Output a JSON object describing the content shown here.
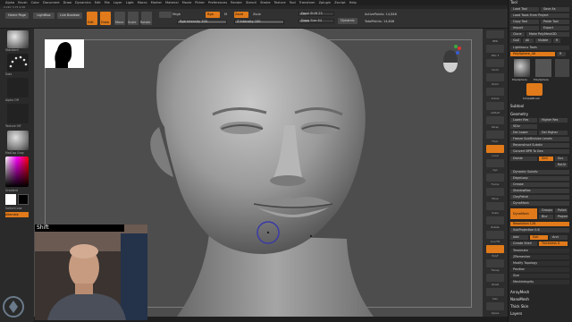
{
  "menu": [
    "Alpha",
    "Brush",
    "Color",
    "Document",
    "Draw",
    "Dynamics",
    "Edit",
    "File",
    "Layer",
    "Light",
    "Macro",
    "Marker",
    "Material",
    "Movie",
    "Picker",
    "Preferences",
    "Render",
    "Stencil",
    "Stroke",
    "Texture",
    "Tool",
    "Transform",
    "Zplugin",
    "Zscript",
    "Help"
  ],
  "version": "4.2R7 3.75 4:28",
  "toolbar": {
    "home_page": "Home Page",
    "lightbox": "LightBox",
    "live_boolean": "Live Boolean",
    "edit": "Edit",
    "draw": "Draw",
    "move": "Move",
    "scale": "Scale",
    "rotate": "Rotate",
    "mrgb": "Mrgb",
    "rgb": "Rgb",
    "m": "M",
    "zadd": "Zadd",
    "zsub": "Zsub",
    "rgb_intensity": "Rgb Intensity 100",
    "z_intensity": "Z Intensity 100",
    "focal_shift": "Focal Shift 25",
    "draw_size": "Draw Size 64",
    "dynamic": "Dynamic",
    "active_points": "ActivePoints: 14,846",
    "total_points": "TotalPoints: 14,846"
  },
  "left_shelf": {
    "brush": "Standard",
    "stroke": "Dots",
    "alpha": "Alpha Off",
    "texture": "Texture Off",
    "material": "MatCap Gray",
    "gradient": "Gradient",
    "switch_color": "SwitchColor",
    "alternate": "Alternate"
  },
  "right_shelf": [
    "BPR",
    "SPix 3",
    "Scroll",
    "Zoom",
    "Actual",
    "AAHalf",
    "Persp",
    "Floor",
    "Local",
    "Gyz",
    "Frame",
    "Move",
    "Scale",
    "Rotate",
    "Line Fill",
    "PolyF",
    "Transp",
    "Ghost",
    "Solo",
    "Xpose"
  ],
  "tray": {
    "title": "Tool",
    "load_tool": "Load Tool",
    "save_as": "Save As",
    "load_tools_from_project": "Load Tools From Project",
    "copy_tool": "Copy Tool",
    "paste_tool": "Paste Tool",
    "import": "Import",
    "export": "Export",
    "clone": "Clone",
    "make_polymesh": "Make PolyMesh3D",
    "goz": "GoZ",
    "all": "All",
    "visible": "Visible",
    "r": "R",
    "lightbox_tools": "Lightbox ▸ Tools",
    "current_tool": "PolySphere_48",
    "r_label": "R",
    "thumb_a": "PolySphere",
    "thumb_b": "PolySphere",
    "thumb_c": "SimpleBrush",
    "subtool": "Subtool",
    "geometry": "Geometry",
    "lower_res": "Lower Res",
    "higher_res": "Higher Res",
    "sdiv": "SDiv",
    "del_lower": "Del Lower",
    "del_higher": "Del Higher",
    "freeze": "Freeze SubDivision Levels",
    "reconstruct": "Reconstruct Subdiv",
    "convert_bpr": "Convert BPR To Geo",
    "divide": "Divide",
    "smt": "Smt",
    "suv": "Suv",
    "reuv": "ReUV",
    "dynamic_subdiv": "Dynamic Subdiv",
    "edgeloop": "EdgeLoop",
    "crease": "Crease",
    "shadowbox": "ShadowBox",
    "claypolish": "ClayPolish",
    "dynamesh": "DynaMesh",
    "dynamesh_btn": "DynaMesh",
    "groups": "Groups",
    "polish": "Polish",
    "blur": "Blur",
    "project": "Project",
    "resolution": "Resolution 128",
    "subprojection": "SubProjection 0.6",
    "add": "Add",
    "sub": "Sub",
    "and": "And",
    "create_shell": "Create Shell",
    "thickness": "Thickness 4",
    "tessimate": "Tessimate",
    "zremesher": "ZRemesher",
    "modify_topology": "Modify Topology",
    "position": "Position",
    "size": "Size",
    "meshintegrity": "MeshIntegrity",
    "arraymesh": "ArrayMesh",
    "nanomesh": "NanoMesh",
    "thick_skin": "Thick Skin",
    "layers": "Layers"
  },
  "overlay": {
    "shift_label": "Shift"
  },
  "colors": {
    "accent": "#e07a1a",
    "bg": "#2b2b2b",
    "canvas": "#4d4d4d"
  }
}
